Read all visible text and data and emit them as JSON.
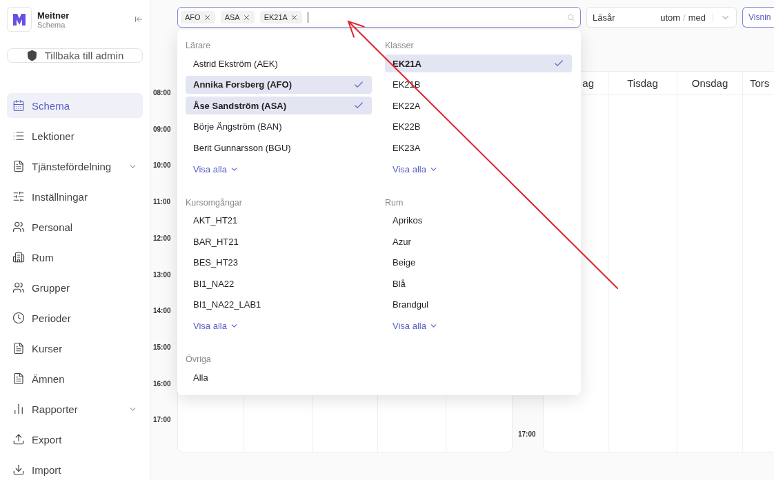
{
  "app": {
    "name": "Meitner",
    "subtitle": "Schema"
  },
  "back_button": "Tillbaka till admin",
  "nav": [
    {
      "label": "Schema",
      "selected": true,
      "expandable": false
    },
    {
      "label": "Lektioner",
      "selected": false,
      "expandable": false
    },
    {
      "label": "Tjänstefördelning",
      "selected": false,
      "expandable": true
    },
    {
      "label": "Inställningar",
      "selected": false,
      "expandable": false
    },
    {
      "label": "Personal",
      "selected": false,
      "expandable": false
    },
    {
      "label": "Rum",
      "selected": false,
      "expandable": false
    },
    {
      "label": "Grupper",
      "selected": false,
      "expandable": false
    },
    {
      "label": "Perioder",
      "selected": false,
      "expandable": false
    },
    {
      "label": "Kurser",
      "selected": false,
      "expandable": false
    },
    {
      "label": "Ämnen",
      "selected": false,
      "expandable": false
    },
    {
      "label": "Rapporter",
      "selected": false,
      "expandable": true
    },
    {
      "label": "Export",
      "selected": false,
      "expandable": false
    },
    {
      "label": "Import",
      "selected": false,
      "expandable": false
    }
  ],
  "search": {
    "chips": [
      "AFO",
      "ASA",
      "EK21A"
    ]
  },
  "year_filter": {
    "label": "Läsår",
    "option_1": "utom",
    "separator": "/",
    "option_2": "med"
  },
  "view_button": "Visnin",
  "dropdown": {
    "sections": [
      {
        "title": "Lärare",
        "show_all": "Visa alla",
        "items": [
          {
            "label": "Astrid Ekström (AEK)",
            "selected": false
          },
          {
            "label": "Annika Forsberg (AFO)",
            "selected": true
          },
          {
            "label": "Åse Sandström (ASA)",
            "selected": true
          },
          {
            "label": "Börje Ängström (BAN)",
            "selected": false
          },
          {
            "label": "Berit Gunnarsson (BGU)",
            "selected": false
          }
        ]
      },
      {
        "title": "Klasser",
        "show_all": "Visa alla",
        "items": [
          {
            "label": "EK21A",
            "selected": true
          },
          {
            "label": "EK21B",
            "selected": false
          },
          {
            "label": "EK22A",
            "selected": false
          },
          {
            "label": "EK22B",
            "selected": false
          },
          {
            "label": "EK23A",
            "selected": false
          }
        ]
      },
      {
        "title": "Kursomgångar",
        "show_all": "Visa alla",
        "items": [
          {
            "label": "AKT_HT21",
            "selected": false
          },
          {
            "label": "BAR_HT21",
            "selected": false
          },
          {
            "label": "BES_HT23",
            "selected": false
          },
          {
            "label": "BI1_NA22",
            "selected": false
          },
          {
            "label": "BI1_NA22_LAB1",
            "selected": false
          }
        ]
      },
      {
        "title": "Rum",
        "show_all": "Visa alla",
        "items": [
          {
            "label": "Aprikos",
            "selected": false
          },
          {
            "label": "Azur",
            "selected": false
          },
          {
            "label": "Beige",
            "selected": false
          },
          {
            "label": "Blå",
            "selected": false
          },
          {
            "label": "Brandgul",
            "selected": false
          }
        ]
      },
      {
        "title": "Övriga",
        "items": [
          {
            "label": "Alla",
            "selected": false
          }
        ]
      }
    ]
  },
  "calendar": {
    "times": [
      "08:00",
      "09:00",
      "10:00",
      "11:00",
      "12:00",
      "13:00",
      "14:00",
      "15:00",
      "16:00",
      "17:00"
    ],
    "second_times": [
      "17:00"
    ],
    "days": [
      "ag",
      "Tisdag",
      "Onsdag",
      "Tors"
    ]
  }
}
